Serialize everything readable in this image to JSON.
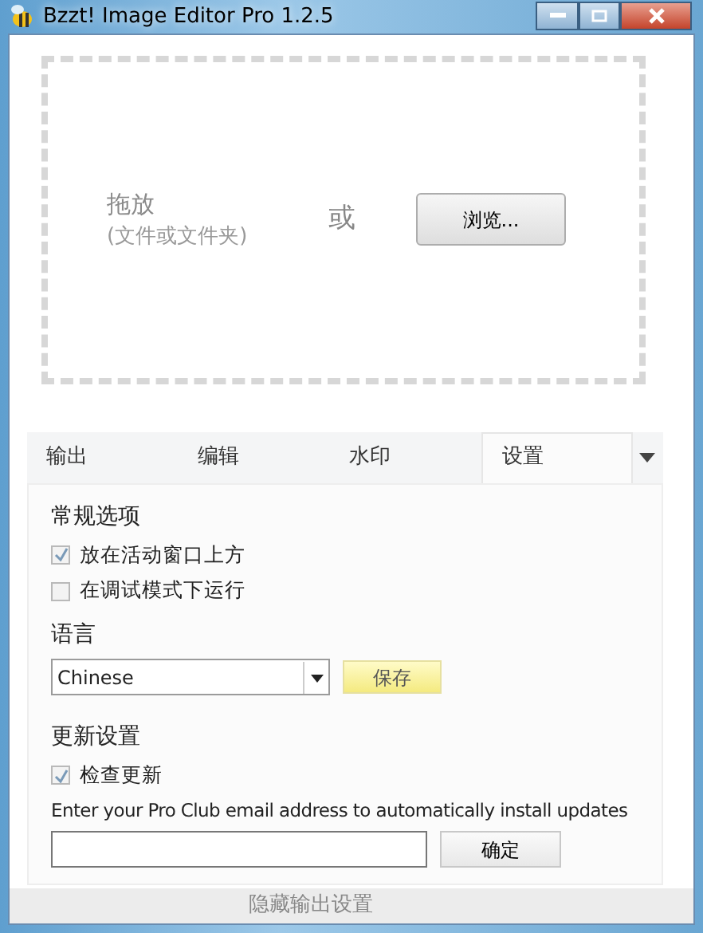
{
  "window": {
    "title": "Bzzt! Image Editor Pro 1.2.5"
  },
  "drop_zone": {
    "label": "拖放",
    "hint": "(文件或文件夹)",
    "or": "或",
    "browse": "浏览..."
  },
  "tabs": [
    {
      "label": "输出",
      "selected": false
    },
    {
      "label": "编辑",
      "selected": false
    },
    {
      "label": "水印",
      "selected": false
    },
    {
      "label": "设置",
      "selected": true
    }
  ],
  "general": {
    "heading": "常规选项",
    "options": [
      {
        "label": "放在活动窗口上方",
        "checked": true
      },
      {
        "label": "在调试模式下运行",
        "checked": false
      }
    ]
  },
  "language": {
    "heading": "语言",
    "value": "Chinese",
    "save": "保存"
  },
  "updates": {
    "heading": "更新设置",
    "options": [
      {
        "label": "检查更新",
        "checked": true
      }
    ],
    "email_hint": "Enter your Pro Club email address to automatically install updates",
    "confirm": "确定"
  },
  "footer": "隐藏输出设置"
}
